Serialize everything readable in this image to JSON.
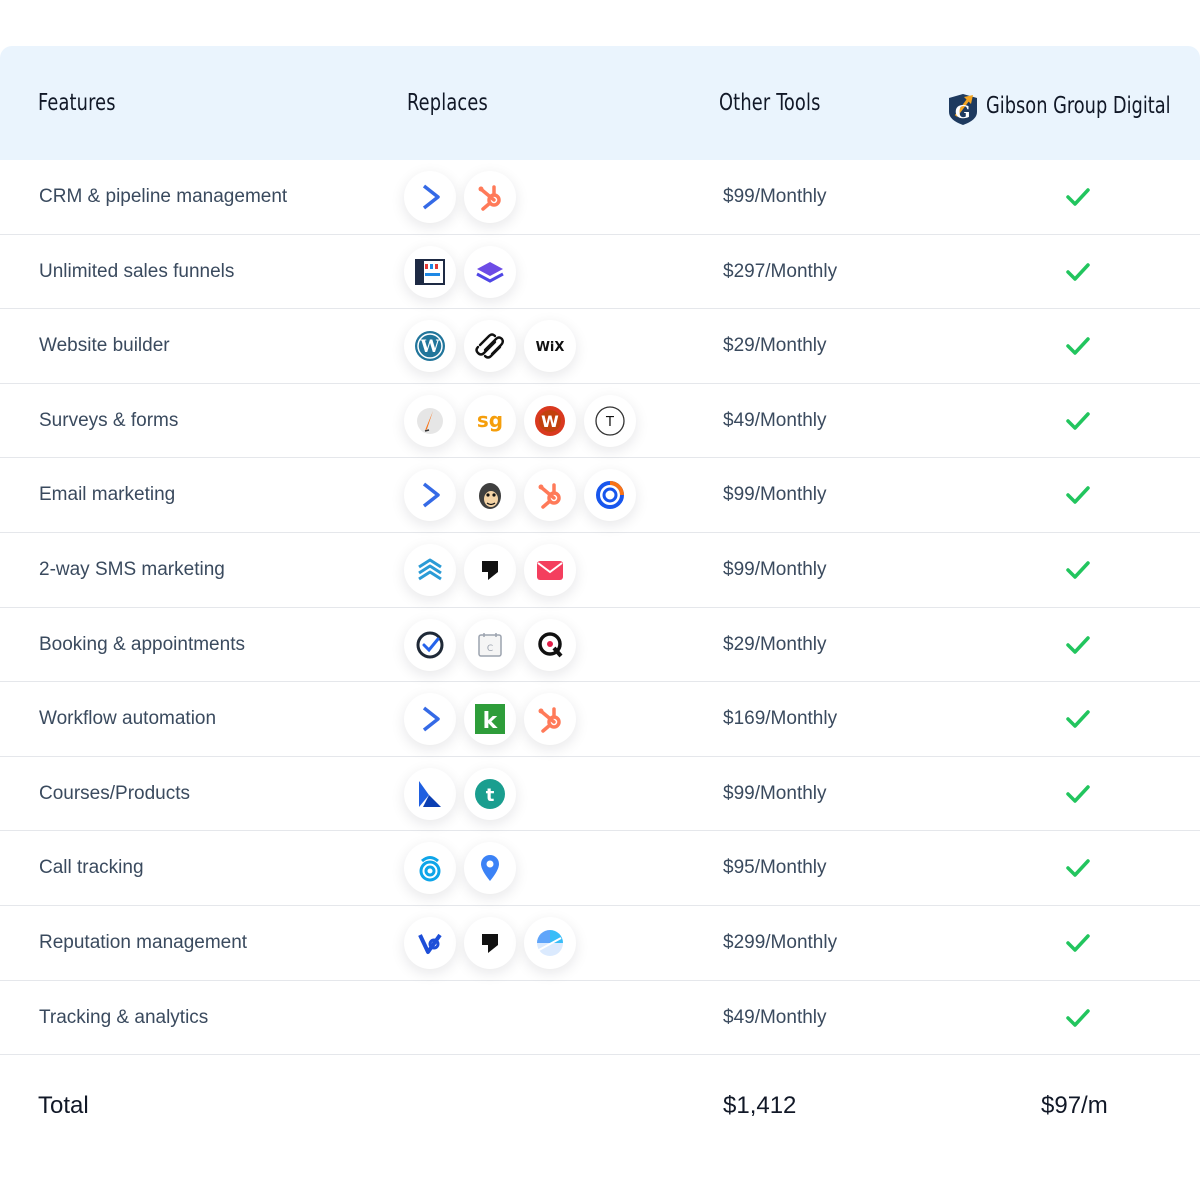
{
  "header": {
    "features": "Features",
    "replaces": "Replaces",
    "other_tools": "Other Tools",
    "brand": "Gibson Group Digital",
    "brand_icon": "gibson-group-logo-icon"
  },
  "colors": {
    "header_bg": "#eaf4fd",
    "check": "#22c55e",
    "text": "#3a4a5e"
  },
  "rows": [
    {
      "feature": "CRM & pipeline management",
      "price": "$99/Monthly",
      "icons": [
        "activecampaign-icon",
        "hubspot-icon"
      ]
    },
    {
      "feature": "Unlimited sales funnels",
      "price": "$297/Monthly",
      "icons": [
        "clickfunnels-icon",
        "kartra-stack-icon"
      ]
    },
    {
      "feature": "Website builder",
      "price": "$29/Monthly",
      "icons": [
        "wordpress-icon",
        "squarespace-icon",
        "wix-icon"
      ],
      "wix_label": "WiX"
    },
    {
      "feature": "Surveys & forms",
      "price": "$49/Monthly",
      "icons": [
        "jotform-icon",
        "surveygizmo-icon",
        "wufoo-icon",
        "typeform-icon"
      ],
      "sg_label": "sg",
      "t_label": "T"
    },
    {
      "feature": "Email marketing",
      "price": "$99/Monthly",
      "icons": [
        "activecampaign-icon",
        "mailchimp-icon",
        "hubspot-icon",
        "constant-contact-icon"
      ]
    },
    {
      "feature": "2-way SMS marketing",
      "price": "$99/Monthly",
      "icons": [
        "smsbump-icon",
        "podium-icon",
        "mail-icon"
      ]
    },
    {
      "feature": "Booking & appointments",
      "price": "$29/Monthly",
      "icons": [
        "acuity-check-icon",
        "calendly-icon",
        "oncehub-icon"
      ],
      "c_label": "C"
    },
    {
      "feature": "Workflow automation",
      "price": "$169/Monthly",
      "icons": [
        "activecampaign-icon",
        "keap-icon",
        "hubspot-icon"
      ],
      "k_label": "k"
    },
    {
      "feature": "Courses/Products",
      "price": "$99/Monthly",
      "icons": [
        "kajabi-icon",
        "teachable-icon"
      ],
      "t_label": "t"
    },
    {
      "feature": "Call tracking",
      "price": "$95/Monthly",
      "icons": [
        "callrail-icon",
        "location-pin-icon"
      ]
    },
    {
      "feature": "Reputation management",
      "price": "$299/Monthly",
      "icons": [
        "birdeye-icon",
        "podium-icon",
        "yext-icon"
      ]
    },
    {
      "feature": "Tracking & analytics",
      "price": "$49/Monthly",
      "icons": []
    }
  ],
  "total": {
    "label": "Total",
    "other": "$1,412",
    "gibson": "$97/m"
  }
}
